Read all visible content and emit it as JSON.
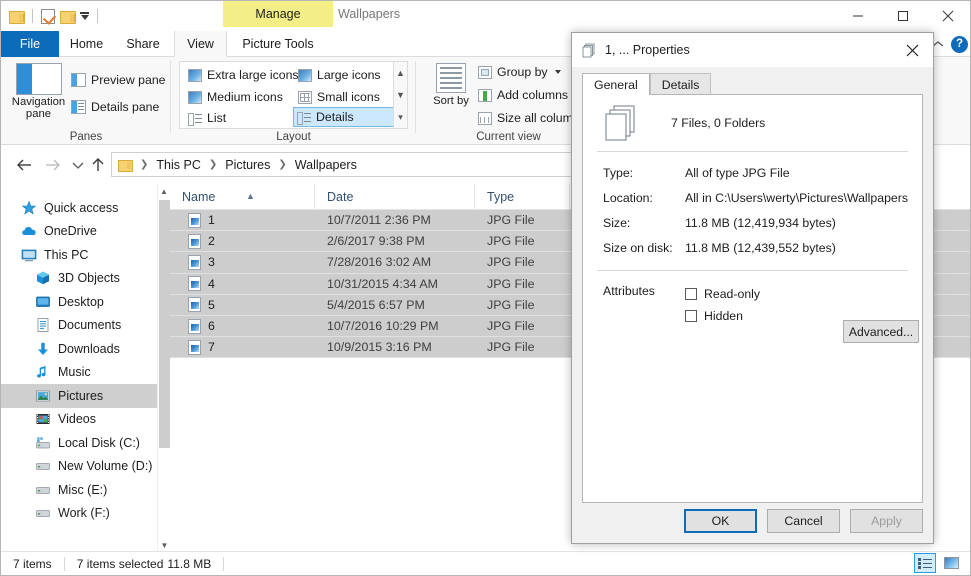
{
  "window": {
    "title": "Wallpapers",
    "manage_tab": "Manage",
    "quick_access": [
      "new-folder-icon",
      "properties-icon",
      "folder-dropdown-icon"
    ],
    "controls": {
      "minimize": "minimize-icon",
      "maximize": "maximize-icon",
      "close": "close-icon"
    }
  },
  "ribbon": {
    "tabs": [
      {
        "label": "File"
      },
      {
        "label": "Home"
      },
      {
        "label": "Share"
      },
      {
        "label": "View"
      },
      {
        "label": "Picture Tools"
      }
    ],
    "collapse_icon": "chevron-up-icon",
    "help_icon": "?",
    "groups": {
      "panes": {
        "label": "Panes",
        "navigation_pane": "Navigation pane",
        "preview_pane": "Preview pane",
        "details_pane": "Details pane"
      },
      "layout": {
        "label": "Layout",
        "items": [
          "Extra large icons",
          "Large icons",
          "Medium icons",
          "Small icons",
          "List",
          "Details"
        ],
        "selected": "Details"
      },
      "current_view": {
        "label": "Current view",
        "sort_by": "Sort by",
        "group_by": "Group by",
        "add_columns": "Add columns",
        "size_all_columns": "Size all columns"
      }
    }
  },
  "address_bar": {
    "back_icon": "back-arrow-icon",
    "forward_icon": "forward-arrow-icon",
    "recent_icon": "recent-locations-icon",
    "up_icon": "up-arrow-icon",
    "breadcrumbs": [
      "This PC",
      "Pictures",
      "Wallpapers"
    ]
  },
  "navigation_pane": {
    "items": [
      {
        "label": "Quick access",
        "icon": "star-icon",
        "level": 0,
        "selected": false
      },
      {
        "label": "OneDrive",
        "icon": "cloud-icon",
        "level": 0,
        "selected": false
      },
      {
        "label": "This PC",
        "icon": "monitor-icon",
        "level": 0,
        "selected": false
      },
      {
        "label": "3D Objects",
        "icon": "cube-icon",
        "level": 1,
        "selected": false
      },
      {
        "label": "Desktop",
        "icon": "desktop-icon",
        "level": 1,
        "selected": false
      },
      {
        "label": "Documents",
        "icon": "document-icon",
        "level": 1,
        "selected": false
      },
      {
        "label": "Downloads",
        "icon": "download-arrow-icon",
        "level": 1,
        "selected": false
      },
      {
        "label": "Music",
        "icon": "music-note-icon",
        "level": 1,
        "selected": false
      },
      {
        "label": "Pictures",
        "icon": "picture-icon",
        "level": 1,
        "selected": true
      },
      {
        "label": "Videos",
        "icon": "film-icon",
        "level": 1,
        "selected": false
      },
      {
        "label": "Local Disk (C:)",
        "icon": "system-drive-icon",
        "level": 1,
        "selected": false
      },
      {
        "label": "New Volume (D:)",
        "icon": "drive-icon",
        "level": 1,
        "selected": false
      },
      {
        "label": "Misc (E:)",
        "icon": "drive-icon",
        "level": 1,
        "selected": false
      },
      {
        "label": "Work (F:)",
        "icon": "drive-icon",
        "level": 1,
        "selected": false
      }
    ]
  },
  "file_list": {
    "columns": [
      "Name",
      "Date",
      "Type"
    ],
    "sort_column": "Name",
    "sort_direction": "ascending",
    "rows": [
      {
        "name": "1",
        "date": "10/7/2011 2:36 PM",
        "type": "JPG File",
        "selected": true
      },
      {
        "name": "2",
        "date": "2/6/2017 9:38 PM",
        "type": "JPG File",
        "selected": true
      },
      {
        "name": "3",
        "date": "7/28/2016 3:02 AM",
        "type": "JPG File",
        "selected": true
      },
      {
        "name": "4",
        "date": "10/31/2015 4:34 AM",
        "type": "JPG File",
        "selected": true
      },
      {
        "name": "5",
        "date": "5/4/2015 6:57 PM",
        "type": "JPG File",
        "selected": true
      },
      {
        "name": "6",
        "date": "10/7/2016 10:29 PM",
        "type": "JPG File",
        "selected": true
      },
      {
        "name": "7",
        "date": "10/9/2015 3:16 PM",
        "type": "JPG File",
        "selected": true
      }
    ]
  },
  "status_bar": {
    "item_count": "7 items",
    "selection": "7 items selected",
    "size": "11.8 MB",
    "details_view_icon": "details-view-icon",
    "large_icons_view_icon": "large-icons-view-icon"
  },
  "dialog": {
    "title": "1, ... Properties",
    "close_icon": "close-icon",
    "tabs": [
      {
        "label": "General",
        "active": true
      },
      {
        "label": "Details",
        "active": false
      }
    ],
    "summary": "7 Files, 0 Folders",
    "fields": [
      {
        "label": "Type:",
        "value": "All of type JPG File"
      },
      {
        "label": "Location:",
        "value": "All in C:\\Users\\werty\\Pictures\\Wallpapers"
      },
      {
        "label": "Size:",
        "value": "11.8 MB (12,419,934 bytes)"
      },
      {
        "label": "Size on disk:",
        "value": "11.8 MB (12,439,552 bytes)"
      }
    ],
    "attributes_label": "Attributes",
    "checkboxes": [
      {
        "label": "Read-only",
        "checked": false
      },
      {
        "label": "Hidden",
        "checked": false
      }
    ],
    "advanced_button": "Advanced...",
    "buttons": [
      {
        "label": "OK",
        "style": "primary"
      },
      {
        "label": "Cancel",
        "style": "normal"
      },
      {
        "label": "Apply",
        "style": "disabled"
      }
    ]
  },
  "colors": {
    "accent": "#0d6cb9",
    "manage_tab": "#f3ee86",
    "selection": "#cdcdcd",
    "layout_selected": "#cce8ff"
  }
}
